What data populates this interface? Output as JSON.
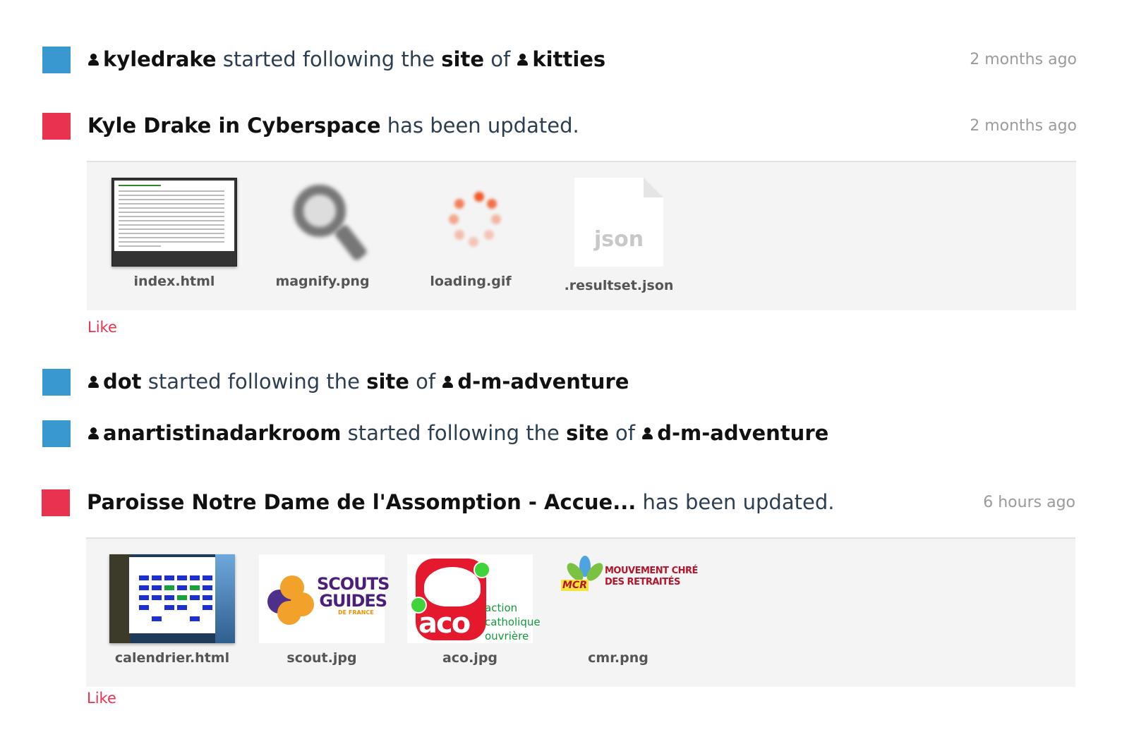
{
  "events": [
    {
      "kind": "follow",
      "follower": "kyledrake",
      "text_mid": "started following the",
      "site_word": "site",
      "of_word": "of",
      "target": "kitties",
      "time": "2 months ago"
    },
    {
      "kind": "update",
      "site_title": "Kyle Drake in Cyberspace",
      "suffix": "has been updated.",
      "time": "2 months ago",
      "files": [
        "index.html",
        "magnify.png",
        "loading.gif",
        ".resultset.json"
      ],
      "json_ext": "json",
      "like": "Like"
    },
    {
      "kind": "follow",
      "follower": "dot",
      "text_mid": "started following the",
      "site_word": "site",
      "of_word": "of",
      "target": "d-m-adventure"
    },
    {
      "kind": "follow",
      "follower": "anartistinadarkroom",
      "text_mid": "started following the",
      "site_word": "site",
      "of_word": "of",
      "target": "d-m-adventure"
    },
    {
      "kind": "update",
      "site_title": "Paroisse Notre Dame de l'Assomption - Accue...",
      "suffix": "has been updated.",
      "time": "6 hours ago",
      "files": [
        "calendrier.html",
        "scout.jpg",
        "aco.jpg",
        "cmr.png"
      ],
      "logos": {
        "scouts_line1": "SCOUTS",
        "scouts_line2": "GUIDES",
        "scouts_line3": "DE FRANCE",
        "aco_word": "aco",
        "aco_side1": "action",
        "aco_side2": "catholique",
        "aco_side3": "ouvrière",
        "cmr_line1": "MOUVEMENT CHRÉ",
        "cmr_line2": "DES RETRAITÉS",
        "cmr_mark": "MCR"
      },
      "like": "Like"
    }
  ],
  "colors": {
    "follow_marker": "#3a98d1",
    "update_marker": "#e93250",
    "like": "#e93250",
    "time": "#9b9b9b"
  }
}
